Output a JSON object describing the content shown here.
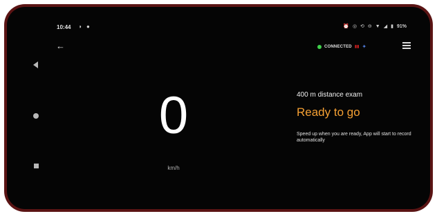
{
  "status_bar": {
    "time": "10:44",
    "battery": "91%"
  },
  "app_bar": {
    "connection_label": "CONNECTED",
    "connection_color": "#3fd14b"
  },
  "speedometer": {
    "speed": "0",
    "unit": "km/h"
  },
  "exam": {
    "title": "400 m distance exam",
    "status": "Ready to go",
    "status_color": "#f5a033",
    "hint": "Speed up when you are ready, App will start to record automatically"
  },
  "icons": {
    "back": "arrow-left-icon",
    "menu": "list-menu-icon",
    "nav_back": "triangle-back-icon",
    "nav_home": "circle-home-icon",
    "nav_recents": "square-recents-icon"
  }
}
